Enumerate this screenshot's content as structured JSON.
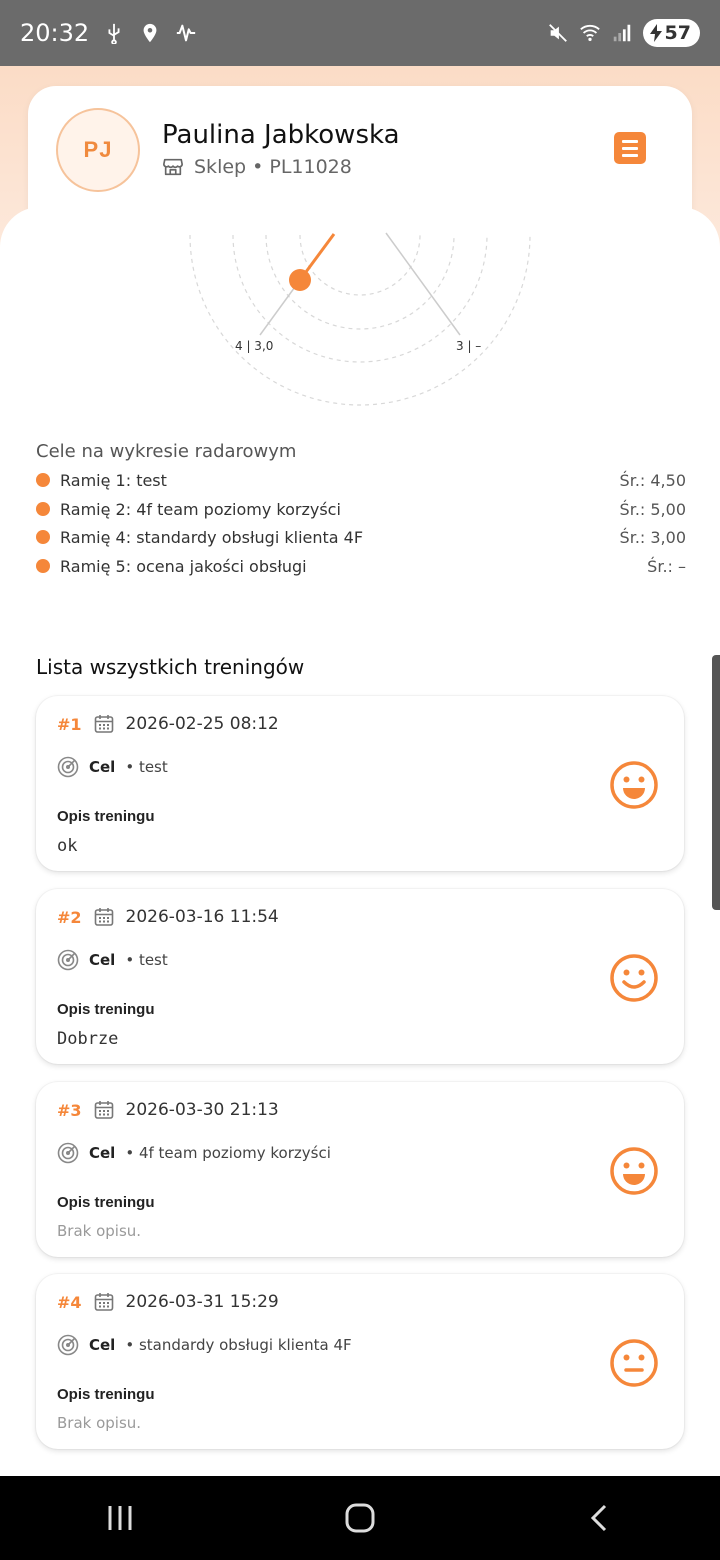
{
  "status_bar": {
    "time": "20:32",
    "battery": "57",
    "wifi_label": "6"
  },
  "profile": {
    "initials": "PJ",
    "name": "Paulina Jabkowska",
    "store_line": "Sklep • PL11028"
  },
  "radar": {
    "axis_labels": [
      "4 | 3,0",
      "3 | –"
    ]
  },
  "goals": {
    "title": "Cele na wykresie radarowym",
    "items": [
      {
        "label": "Ramię 1: test",
        "avg": "Śr.: 4,50"
      },
      {
        "label": "Ramię 2: 4f team poziomy korzyści",
        "avg": "Śr.: 5,00"
      },
      {
        "label": "Ramię 4: standardy obsługi klienta 4F",
        "avg": "Śr.: 3,00"
      },
      {
        "label": "Ramię 5: ocena jakości obsługi",
        "avg": "Śr.: –"
      }
    ]
  },
  "trainings": {
    "title": "Lista wszystkich treningów",
    "goal_label": "Cel",
    "desc_label": "Opis treningu",
    "items": [
      {
        "num": "#1",
        "date": "2026-02-25 08:12",
        "goal": "• test",
        "desc": "ok",
        "mood": "happy"
      },
      {
        "num": "#2",
        "date": "2026-03-16 11:54",
        "goal": "• test",
        "desc": "Dobrze",
        "mood": "smile"
      },
      {
        "num": "#3",
        "date": "2026-03-30 21:13",
        "goal": "• 4f team poziomy korzyści",
        "desc": "Brak opisu.",
        "mood": "happy"
      },
      {
        "num": "#4",
        "date": "2026-03-31 15:29",
        "goal": "• standardy obsługi klienta 4F",
        "desc": "Brak opisu.",
        "mood": "neutral"
      }
    ]
  },
  "colors": {
    "accent": "#f5873a",
    "header_bg": "#fbdcc6"
  }
}
